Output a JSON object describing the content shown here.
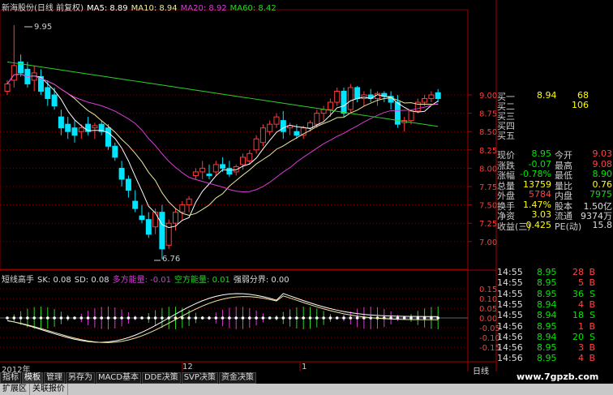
{
  "header": {
    "title": "新海股份(日线 前复权)",
    "ma5": "MA5: 8.89",
    "ma10": "MA10: 8.94",
    "ma20": "MA20: 8.92",
    "ma60": "MA60: 8.42"
  },
  "chart": {
    "high_label": "9.95",
    "low_label": "6.76",
    "price_ticks": [
      "9.00",
      "8.75",
      "8.50",
      "8.25",
      "8.00",
      "7.75",
      "7.50",
      "7.25",
      "7.00"
    ],
    "year_label": "2012年",
    "month_labels": [
      "12",
      "1"
    ],
    "period_label": "日线",
    "colors": {
      "up": "#ff3b3b",
      "down": "#00e5ff",
      "ma5": "#ffffff",
      "ma10": "#e8e8a0",
      "ma20": "#d63cd6",
      "ma60": "#2bd32b",
      "grid": "#7a0000"
    }
  },
  "indicator": {
    "name": "短线高手",
    "sk": "SK: 0.08",
    "sd": "SD: 0.08",
    "bull": "多方能量: -0.01",
    "bear": "空方能量: 0.01",
    "boundary": "强弱分界: 0.00",
    "ticks": [
      "0.15",
      "0.10",
      "0.05",
      "0.00",
      "-0.05",
      "-0.10",
      "-0.15"
    ]
  },
  "quote_book": [
    {
      "label": "买一",
      "price": "8.94",
      "vol": "68"
    },
    {
      "label": "买二",
      "price": "",
      "vol": "106"
    },
    {
      "label": "买三",
      "price": "",
      "vol": ""
    },
    {
      "label": "买四",
      "price": "",
      "vol": ""
    },
    {
      "label": "买五",
      "price": "",
      "vol": ""
    }
  ],
  "stats": [
    {
      "l1": "现价",
      "v1": "8.95",
      "l2": "今开",
      "v2": "9.03"
    },
    {
      "l1": "涨跌",
      "v1": "-0.07",
      "l2": "最高",
      "v2": "9.08"
    },
    {
      "l1": "涨幅",
      "v1": "-0.78%",
      "l2": "最低",
      "v2": "8.90"
    },
    {
      "l1": "总量",
      "v1": "13759",
      "l2": "量比",
      "v2": "0.76"
    },
    {
      "l1": "外盘",
      "v1": "5784",
      "l2": "内盘",
      "v2": "7975"
    },
    {
      "l1": "换手",
      "v1": "1.47%",
      "l2": "股本",
      "v2": "1.50亿"
    },
    {
      "l1": "净资",
      "v1": "3.03",
      "l2": "流通",
      "v2": "9374万"
    },
    {
      "l1": "收益(三)",
      "v1": "0.425",
      "l2": "PE(动)",
      "v2": "15.8"
    }
  ],
  "ticks": [
    {
      "time": "14:55",
      "price": "8.95",
      "vol": "28",
      "side": "B"
    },
    {
      "time": "14:55",
      "price": "8.95",
      "vol": "5",
      "side": "B"
    },
    {
      "time": "14:55",
      "price": "8.95",
      "vol": "36",
      "side": "S"
    },
    {
      "time": "14:55",
      "price": "8.94",
      "vol": "4",
      "side": "B"
    },
    {
      "time": "14:55",
      "price": "8.94",
      "vol": "18",
      "side": "S"
    },
    {
      "time": "14:56",
      "price": "8.95",
      "vol": "1",
      "side": "B"
    },
    {
      "time": "14:56",
      "price": "8.94",
      "vol": "20",
      "side": "S"
    },
    {
      "time": "14:56",
      "price": "8.95",
      "vol": "3",
      "side": "B"
    },
    {
      "time": "14:56",
      "price": "8.95",
      "vol": "4",
      "side": "B"
    }
  ],
  "tabs": [
    "指标",
    "模板",
    "管理",
    "另存为",
    "MACD基本",
    "DDE决策",
    "SVP决策",
    "资金决策"
  ],
  "status": [
    "扩展区",
    "关联报价"
  ],
  "watermark": "www.7gpzb.com"
}
